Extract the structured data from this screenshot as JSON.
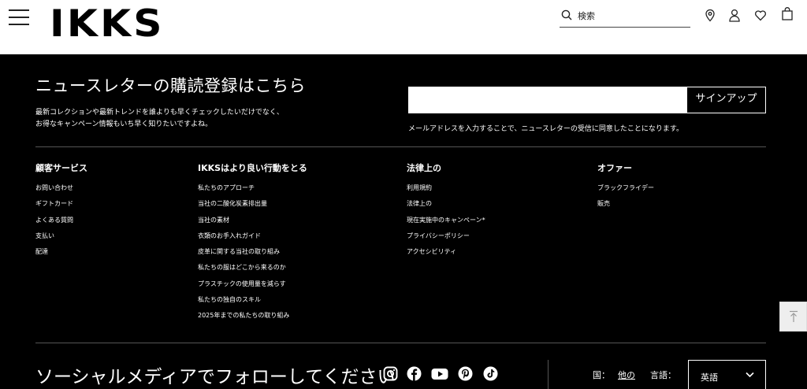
{
  "header": {
    "logo": "IKKS",
    "search_placeholder": "検索"
  },
  "newsletter": {
    "title": "ニュースレターの購読登録はこちら",
    "desc_line1": "最新コレクションや最新トレンドを誰よりも早くチェックしたいだけでなく、",
    "desc_line2": "お得なキャンペーン情報もいち早く知りたいですよね。",
    "signup_label": "サインアップ",
    "consent": "メールアドレスを入力することで、ニュースレターの受信に同意したことになります。"
  },
  "columns": [
    {
      "title": "顧客サービス",
      "items": [
        "お問い合わせ",
        "ギフトカード",
        "よくある質問",
        "支払い",
        "配達"
      ]
    },
    {
      "title": "IKKSはより良い行動をとる",
      "items": [
        "私たちのアプローチ",
        "当社の二酸化炭素排出量",
        "当社の素材",
        "衣類のお手入れガイド",
        "皮革に関する当社の取り組み",
        "私たちの服はどこから来るのか",
        "プラスチックの使用量を減らす",
        "私たちの独自のスキル",
        "2025年までの私たちの取り組み"
      ]
    },
    {
      "title": "法律上の",
      "items": [
        "利用規約",
        "法律上の",
        "現在実施中のキャンペーン*",
        "プライバシーポリシー",
        "アクセシビリティ"
      ]
    },
    {
      "title": "オファー",
      "items": [
        "ブラックフライデー",
        "販売"
      ]
    }
  ],
  "social": {
    "title": "ソーシャルメディアでフォローしてください",
    "icons": [
      "instagram-icon",
      "facebook-icon",
      "youtube-icon",
      "pinterest-icon",
      "tiktok-icon"
    ]
  },
  "locale": {
    "country_label": "国：",
    "country_value": "他の",
    "language_label": "言語：",
    "language_value": "英語"
  },
  "colors": {
    "footer_bg": "#000000",
    "text_light": "#ffffff"
  }
}
